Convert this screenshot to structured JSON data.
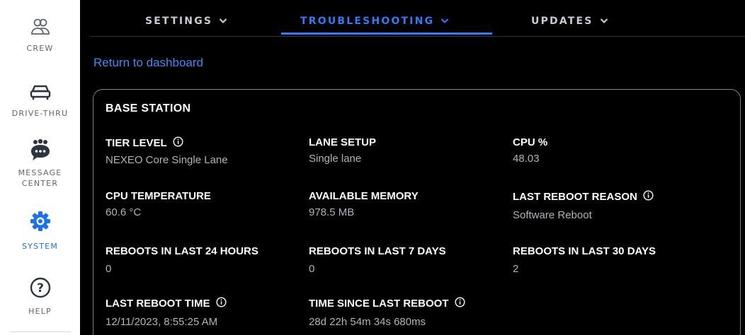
{
  "sidebar": {
    "items": [
      {
        "label": "CREW",
        "icon": "crew-icon"
      },
      {
        "label": "DRIVE-THRU",
        "icon": "car-icon"
      },
      {
        "label": "MESSAGE\nCENTER",
        "icon": "message-center-icon"
      },
      {
        "label": "SYSTEM",
        "icon": "gear-icon",
        "active": true
      },
      {
        "label": "HELP",
        "icon": "help-icon"
      }
    ]
  },
  "tabs": [
    {
      "label": "SETTINGS"
    },
    {
      "label": "TROUBLESHOOTING",
      "active": true
    },
    {
      "label": "UPDATES"
    }
  ],
  "return_link": "Return to dashboard",
  "card": {
    "title": "BASE STATION",
    "fields": [
      {
        "label": "TIER LEVEL",
        "value": "NEXEO Core Single Lane",
        "info": true
      },
      {
        "label": "LANE SETUP",
        "value": "Single lane",
        "info": false
      },
      {
        "label": "CPU %",
        "value": "48.03",
        "info": false
      },
      {
        "label": "CPU TEMPERATURE",
        "value": "60.6 °C",
        "info": false
      },
      {
        "label": "AVAILABLE MEMORY",
        "value": "978.5 MB",
        "info": false
      },
      {
        "label": "LAST REBOOT REASON",
        "value": "Software Reboot",
        "info": true
      },
      {
        "label": "REBOOTS IN LAST 24 HOURS",
        "value": "0",
        "info": false
      },
      {
        "label": "REBOOTS IN LAST 7 DAYS",
        "value": "0",
        "info": false
      },
      {
        "label": "REBOOTS IN LAST 30 DAYS",
        "value": "2",
        "info": false
      },
      {
        "label": "LAST REBOOT TIME",
        "value": "12/11/2023, 8:55:25 AM",
        "info": true
      },
      {
        "label": "TIME SINCE LAST REBOOT",
        "value": "28d 22h 54m 34s 680ms",
        "info": true
      }
    ]
  },
  "colors": {
    "accent": "#2f7cf6",
    "link": "#3b8bf7",
    "background": "#000000",
    "sidebar_bg": "#ffffff",
    "label_gray": "#5f6670",
    "value_gray": "#aeb4bb"
  }
}
